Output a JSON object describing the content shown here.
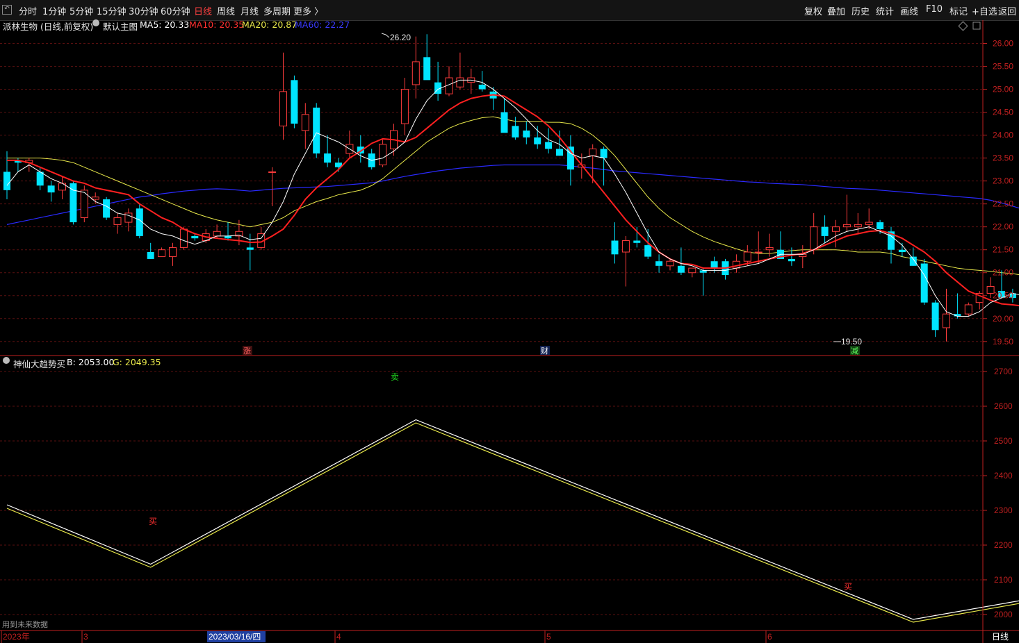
{
  "toolbar": {
    "left_items": [
      "分时",
      "1分钟",
      "5分钟",
      "15分钟",
      "30分钟",
      "60分钟",
      "日线",
      "周线",
      "月线",
      "多周期",
      "更多 〉"
    ],
    "active_item": "日线",
    "right_items": [
      "复权",
      "叠加",
      "历史",
      "统计",
      "画线",
      "F10",
      "标记",
      "+自选",
      "返回"
    ]
  },
  "main_info": {
    "stock_name": "派林生物 (日线,前复权)",
    "template": "默认主图",
    "ma5": "MA5: 20.33",
    "ma10": "MA10: 20.35",
    "ma20": "MA20: 20.87",
    "ma60": "MA60: 22.27"
  },
  "indicator_info": {
    "name": "神仙大趋势买",
    "b_value": "B: 2053.00",
    "g_value": "G: 2049.35"
  },
  "colors": {
    "up": "#ff3c3c",
    "down": "#00e5ff",
    "ma5": "#ffffff",
    "ma10": "#ff2020",
    "ma20": "#e8e84a",
    "ma60": "#2a2aff",
    "line_b": "#ffffff",
    "line_g": "#e8e84a",
    "axis": "#c02020",
    "grid": "#5a1010"
  },
  "labels": {
    "high_label": "26.20",
    "low_label": "19.50",
    "marker_zhang": "涨",
    "marker_cai": "财",
    "marker_jian": "减",
    "signal_sell": "卖",
    "signal_buy_1": "买",
    "signal_buy_2": "买",
    "future_data_note": "用到未来数据",
    "period_label": "日线"
  },
  "x_axis": {
    "labels": [
      "2023年",
      "3",
      "4",
      "5",
      "6"
    ],
    "cursor_date": "2023/03/16/四"
  },
  "chart_data": [
    {
      "type": "candlestick",
      "title": "派林生物 (日线,前复权)",
      "y_ticks": [
        19.5,
        20.0,
        20.5,
        21.0,
        21.5,
        22.0,
        22.5,
        23.0,
        23.5,
        24.0,
        24.5,
        25.0,
        25.5,
        26.0
      ],
      "ylim": [
        19.3,
        26.25
      ],
      "candles": [
        [
          23.2,
          23.65,
          22.6,
          22.8
        ],
        [
          23.45,
          23.5,
          23.2,
          23.4
        ],
        [
          23.4,
          23.5,
          23.2,
          23.45
        ],
        [
          23.2,
          23.3,
          22.8,
          22.9
        ],
        [
          22.9,
          23.0,
          22.55,
          22.75
        ],
        [
          22.8,
          23.1,
          22.6,
          22.95
        ],
        [
          22.95,
          23.0,
          22.05,
          22.1
        ],
        [
          22.2,
          22.9,
          22.1,
          22.8
        ],
        [
          22.6,
          22.75,
          22.5,
          22.65
        ],
        [
          22.6,
          22.65,
          22.15,
          22.2
        ],
        [
          22.05,
          22.3,
          21.85,
          22.2
        ],
        [
          22.1,
          22.4,
          21.9,
          22.3
        ],
        [
          22.4,
          22.5,
          21.75,
          21.8
        ],
        [
          21.45,
          21.65,
          21.3,
          21.3
        ],
        [
          21.35,
          21.55,
          21.35,
          21.5
        ],
        [
          21.35,
          21.65,
          21.15,
          21.55
        ],
        [
          21.55,
          22.0,
          21.5,
          21.95
        ],
        [
          21.8,
          21.85,
          21.7,
          21.75
        ],
        [
          21.7,
          21.95,
          21.65,
          21.85
        ],
        [
          21.8,
          22.05,
          21.75,
          21.9
        ],
        [
          21.8,
          22.1,
          21.7,
          21.75
        ],
        [
          21.8,
          22.15,
          21.6,
          21.9
        ],
        [
          21.55,
          21.85,
          21.05,
          21.5
        ],
        [
          21.55,
          22.0,
          21.5,
          21.85
        ],
        [
          23.2,
          23.3,
          22.45,
          23.2
        ],
        [
          24.2,
          25.8,
          23.9,
          24.95
        ],
        [
          25.2,
          25.3,
          24.15,
          24.25
        ],
        [
          24.1,
          24.7,
          23.7,
          24.45
        ],
        [
          24.6,
          24.7,
          23.5,
          23.6
        ],
        [
          23.6,
          24.0,
          23.3,
          23.4
        ],
        [
          23.4,
          23.5,
          23.2,
          23.3
        ],
        [
          23.6,
          24.1,
          23.5,
          23.8
        ],
        [
          23.75,
          24.0,
          23.4,
          23.6
        ],
        [
          23.6,
          23.7,
          23.25,
          23.3
        ],
        [
          23.35,
          23.9,
          23.3,
          23.8
        ],
        [
          23.7,
          24.25,
          23.55,
          24.1
        ],
        [
          24.25,
          25.25,
          24.0,
          25.0
        ],
        [
          25.1,
          26.15,
          24.8,
          25.6
        ],
        [
          25.7,
          26.2,
          25.3,
          25.2
        ],
        [
          25.15,
          25.6,
          24.75,
          24.9
        ],
        [
          24.9,
          25.5,
          24.85,
          25.25
        ],
        [
          25.05,
          25.8,
          25.0,
          25.25
        ],
        [
          25.15,
          25.45,
          24.9,
          25.25
        ],
        [
          25.1,
          25.4,
          24.95,
          25.0
        ],
        [
          24.95,
          25.05,
          24.55,
          24.8
        ],
        [
          24.5,
          24.8,
          24.1,
          24.05
        ],
        [
          24.2,
          24.4,
          23.9,
          23.95
        ],
        [
          24.1,
          24.3,
          23.8,
          23.95
        ],
        [
          23.95,
          24.2,
          23.7,
          23.8
        ],
        [
          23.85,
          24.15,
          23.6,
          23.7
        ],
        [
          23.7,
          24.1,
          23.55,
          23.55
        ],
        [
          23.75,
          24.0,
          22.9,
          23.25
        ],
        [
          23.3,
          23.6,
          23.05,
          23.35
        ],
        [
          23.55,
          23.8,
          22.95,
          23.7
        ],
        [
          23.7,
          23.75,
          22.9,
          23.5
        ],
        [
          21.7,
          22.1,
          21.2,
          21.4
        ],
        [
          21.45,
          21.8,
          20.7,
          21.7
        ],
        [
          21.7,
          22.0,
          21.55,
          21.65
        ],
        [
          21.6,
          21.95,
          21.3,
          21.35
        ],
        [
          21.25,
          21.4,
          21.0,
          21.15
        ],
        [
          21.15,
          21.3,
          21.05,
          21.25
        ],
        [
          21.15,
          21.55,
          20.95,
          21.0
        ],
        [
          21.0,
          21.1,
          20.9,
          21.1
        ],
        [
          21.05,
          21.1,
          20.5,
          21.0
        ],
        [
          21.25,
          21.35,
          21.0,
          21.1
        ],
        [
          21.25,
          21.3,
          20.85,
          20.95
        ],
        [
          21.1,
          21.4,
          21.0,
          21.25
        ],
        [
          21.25,
          21.6,
          21.15,
          21.45
        ],
        [
          21.45,
          21.9,
          21.2,
          21.45
        ],
        [
          21.5,
          21.85,
          21.35,
          21.55
        ],
        [
          21.5,
          21.9,
          21.4,
          21.3
        ],
        [
          21.3,
          21.55,
          21.15,
          21.25
        ],
        [
          21.35,
          21.6,
          21.1,
          21.4
        ],
        [
          21.5,
          22.3,
          21.4,
          22.0
        ],
        [
          22.0,
          22.25,
          21.65,
          21.8
        ],
        [
          21.9,
          22.15,
          21.55,
          22.0
        ],
        [
          22.0,
          22.7,
          21.9,
          22.05
        ],
        [
          22.0,
          22.3,
          21.85,
          22.05
        ],
        [
          22.05,
          22.4,
          21.95,
          22.1
        ],
        [
          22.1,
          22.15,
          21.85,
          21.95
        ],
        [
          21.9,
          22.0,
          21.2,
          21.5
        ],
        [
          21.5,
          21.65,
          21.35,
          21.45
        ],
        [
          21.35,
          21.55,
          21.15,
          21.15
        ],
        [
          21.2,
          21.3,
          20.3,
          20.35
        ],
        [
          20.35,
          20.4,
          19.6,
          19.75
        ],
        [
          19.8,
          20.65,
          19.5,
          20.1
        ],
        [
          20.1,
          20.55,
          20.0,
          20.05
        ],
        [
          20.1,
          20.35,
          20.05,
          20.3
        ],
        [
          20.35,
          20.6,
          20.2,
          20.55
        ],
        [
          20.55,
          20.9,
          20.45,
          20.7
        ],
        [
          20.6,
          21.05,
          20.5,
          20.45
        ],
        [
          20.55,
          20.65,
          20.35,
          20.45
        ],
        [
          20.4,
          20.45,
          20.2,
          20.2
        ],
        [
          20.1,
          20.15,
          19.9,
          19.95
        ],
        [
          20.05,
          20.65,
          20.0,
          20.5
        ]
      ],
      "ma5": [
        22.9,
        23.2,
        23.35,
        23.2,
        23.05,
        22.95,
        22.8,
        22.75,
        22.55,
        22.45,
        22.3,
        22.25,
        22.15,
        21.95,
        21.85,
        21.8,
        21.7,
        21.62,
        21.7,
        21.8,
        21.8,
        21.82,
        21.72,
        21.75,
        22.1,
        22.55,
        23.15,
        23.6,
        24.05,
        23.95,
        23.85,
        23.7,
        23.55,
        23.45,
        23.5,
        23.65,
        23.85,
        24.35,
        24.75,
        25.0,
        25.1,
        25.2,
        25.2,
        25.15,
        25.0,
        24.8,
        24.6,
        24.35,
        24.1,
        23.9,
        23.8,
        23.6,
        23.5,
        23.55,
        23.5,
        23.15,
        22.75,
        22.3,
        21.85,
        21.45,
        21.3,
        21.2,
        21.15,
        21.05,
        21.05,
        21.05,
        21.1,
        21.15,
        21.2,
        21.3,
        21.4,
        21.4,
        21.4,
        21.5,
        21.65,
        21.8,
        21.9,
        21.95,
        22.0,
        21.9,
        21.8,
        21.6,
        21.3,
        20.95,
        20.5,
        20.15,
        20.05,
        20.05,
        20.15,
        20.35,
        20.45,
        20.55,
        20.5,
        20.35,
        20.33
      ],
      "ma10": [
        23.45,
        23.45,
        23.4,
        23.3,
        23.2,
        23.1,
        23.0,
        22.95,
        22.85,
        22.8,
        22.75,
        22.7,
        22.5,
        22.35,
        22.2,
        22.1,
        21.95,
        21.85,
        21.78,
        21.75,
        21.72,
        21.7,
        21.66,
        21.67,
        21.8,
        21.95,
        22.25,
        22.6,
        22.85,
        23.05,
        23.25,
        23.5,
        23.65,
        23.82,
        23.92,
        23.9,
        23.85,
        23.95,
        24.15,
        24.35,
        24.55,
        24.7,
        24.8,
        24.85,
        24.88,
        24.85,
        24.7,
        24.55,
        24.4,
        24.2,
        23.95,
        23.65,
        23.35,
        23.05,
        22.75,
        22.45,
        22.15,
        21.9,
        21.65,
        21.45,
        21.3,
        21.2,
        21.18,
        21.1,
        21.1,
        21.1,
        21.15,
        21.2,
        21.25,
        21.3,
        21.35,
        21.38,
        21.42,
        21.5,
        21.6,
        21.7,
        21.8,
        21.85,
        21.9,
        21.92,
        21.85,
        21.75,
        21.6,
        21.45,
        21.25,
        21.0,
        20.8,
        20.6,
        20.5,
        20.4,
        20.32,
        20.3,
        20.27,
        20.25,
        20.35
      ],
      "ma20": [
        23.5,
        23.5,
        23.5,
        23.5,
        23.48,
        23.45,
        23.4,
        23.3,
        23.2,
        23.1,
        23.0,
        22.9,
        22.8,
        22.7,
        22.6,
        22.5,
        22.4,
        22.3,
        22.22,
        22.15,
        22.1,
        22.05,
        22.0,
        22.05,
        22.1,
        22.2,
        22.35,
        22.45,
        22.55,
        22.62,
        22.7,
        22.75,
        22.8,
        22.9,
        23.05,
        23.25,
        23.45,
        23.65,
        23.85,
        24.0,
        24.15,
        24.25,
        24.32,
        24.38,
        24.4,
        24.35,
        24.3,
        24.3,
        24.3,
        24.28,
        24.28,
        24.25,
        24.15,
        24.0,
        23.8,
        23.55,
        23.25,
        22.95,
        22.65,
        22.4,
        22.2,
        22.05,
        21.9,
        21.78,
        21.68,
        21.6,
        21.52,
        21.45,
        21.42,
        21.42,
        21.45,
        21.48,
        21.5,
        21.5,
        21.5,
        21.5,
        21.48,
        21.45,
        21.45,
        21.45,
        21.42,
        21.35,
        21.3,
        21.25,
        21.2,
        21.15,
        21.1,
        21.07,
        21.05,
        21.03,
        21.0,
        20.98,
        20.94,
        20.9,
        20.87
      ],
      "ma60": [
        22.05,
        22.1,
        22.15,
        22.2,
        22.25,
        22.3,
        22.35,
        22.4,
        22.45,
        22.5,
        22.55,
        22.6,
        22.65,
        22.68,
        22.72,
        22.75,
        22.78,
        22.8,
        22.82,
        22.83,
        22.82,
        22.8,
        22.78,
        22.8,
        22.82,
        22.84,
        22.85,
        22.86,
        22.87,
        22.88,
        22.9,
        22.92,
        22.94,
        22.96,
        23.0,
        23.05,
        23.1,
        23.14,
        23.18,
        23.22,
        23.25,
        23.28,
        23.3,
        23.32,
        23.34,
        23.35,
        23.35,
        23.35,
        23.35,
        23.35,
        23.35,
        23.33,
        23.3,
        23.28,
        23.25,
        23.22,
        23.2,
        23.18,
        23.16,
        23.14,
        23.12,
        23.1,
        23.08,
        23.06,
        23.04,
        23.02,
        23.0,
        22.98,
        22.97,
        22.95,
        22.94,
        22.93,
        22.92,
        22.9,
        22.88,
        22.86,
        22.84,
        22.83,
        22.82,
        22.8,
        22.78,
        22.76,
        22.74,
        22.72,
        22.7,
        22.68,
        22.66,
        22.64,
        22.62,
        22.58,
        22.52,
        22.45,
        22.38,
        22.32,
        22.27
      ]
    },
    {
      "type": "line",
      "title": "神仙大趋势买",
      "y_ticks": [
        2000,
        2100,
        2200,
        2300,
        2400,
        2500,
        2600,
        2700
      ],
      "ylim": [
        1960,
        2730
      ],
      "x_index": [
        0,
        13,
        37,
        82,
        94
      ],
      "series": [
        {
          "name": "B",
          "values": [
            2316,
            2145,
            2561,
            1986,
            2053
          ]
        },
        {
          "name": "G",
          "values": [
            2310,
            2140,
            2556,
            1982,
            2049.35
          ]
        }
      ]
    }
  ]
}
